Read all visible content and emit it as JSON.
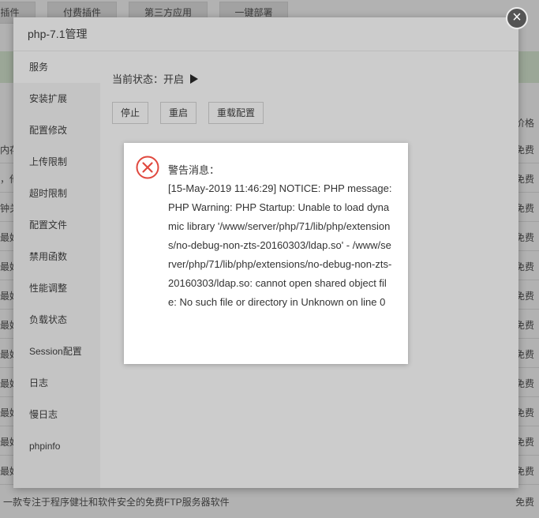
{
  "background": {
    "tabs": [
      "插件",
      "付费插件",
      "第三方应用",
      "一键部署"
    ],
    "column_header": "价格",
    "rows": [
      {
        "left": "内存",
        "right": "免费"
      },
      {
        "left": "，他",
        "right": "免费"
      },
      {
        "left": "钟关",
        "right": "免费"
      },
      {
        "left": "最好",
        "right": "免费"
      },
      {
        "left": "最好",
        "right": "免费"
      },
      {
        "left": "最好",
        "right": "免费"
      },
      {
        "left": "最好",
        "right": "免费"
      },
      {
        "left": "最好",
        "right": "免费"
      },
      {
        "left": "最好",
        "right": "免费"
      },
      {
        "left": "最好",
        "right": "免费"
      },
      {
        "left": "最好",
        "right": "免费"
      },
      {
        "left": "最好",
        "right": "免费"
      }
    ],
    "footer_left": "一款专注于程序健壮和软件安全的免费FTP服务器软件",
    "footer_right": "免费"
  },
  "dialog": {
    "title": "php-7.1管理",
    "close_icon": "close-icon",
    "sidebar": [
      {
        "label": "服务",
        "active": true
      },
      {
        "label": "安装扩展"
      },
      {
        "label": "配置修改"
      },
      {
        "label": "上传限制"
      },
      {
        "label": "超时限制"
      },
      {
        "label": "配置文件"
      },
      {
        "label": "禁用函数"
      },
      {
        "label": "性能调整"
      },
      {
        "label": "负载状态"
      },
      {
        "label": "Session配置"
      },
      {
        "label": "日志"
      },
      {
        "label": "慢日志"
      },
      {
        "label": "phpinfo"
      }
    ],
    "status_label": "当前状态：",
    "status_value": "开启",
    "status_icon": "play-icon",
    "buttons": {
      "stop": "停止",
      "restart": "重启",
      "reload": "重载配置"
    }
  },
  "message": {
    "icon": "error-icon",
    "icon_color": "#e0483e",
    "title": "警告消息：",
    "body": "[15-May-2019 11:46:29] NOTICE: PHP message: PHP Warning: PHP Startup: Unable to load dynamic library '/www/server/php/71/lib/php/extensions/no-debug-non-zts-20160303/ldap.so' - /www/server/php/71/lib/php/extensions/no-debug-non-zts-20160303/ldap.so: cannot open shared object file: No such file or directory in Unknown on line 0"
  }
}
